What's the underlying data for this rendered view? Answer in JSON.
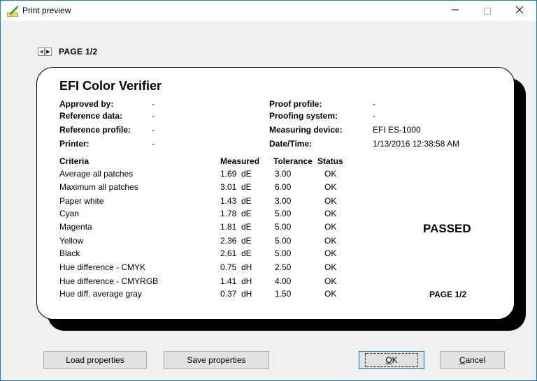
{
  "window": {
    "title": "Print preview"
  },
  "pager": {
    "label": "PAGE 1/2"
  },
  "report": {
    "title": "EFI Color Verifier",
    "left_fields": [
      {
        "label": "Approved by:",
        "value": "-"
      },
      {
        "label": "Reference data:",
        "value": "-"
      },
      {
        "label": "Reference profile:",
        "value": "-"
      },
      {
        "label": "Printer:",
        "value": "-"
      }
    ],
    "right_fields": [
      {
        "label": "Proof profile:",
        "value": "-"
      },
      {
        "label": "Proofing system:",
        "value": "-"
      },
      {
        "label": "Measuring device:",
        "value": "EFI ES-1000"
      },
      {
        "label": "Date/Time:",
        "value": "1/13/2016 12:38:58 AM"
      }
    ],
    "columns": {
      "criteria": "Criteria",
      "measured": "Measured",
      "tolerance": "Tolerance",
      "status": "Status"
    },
    "rows": [
      {
        "criteria": "Average all patches",
        "measured": "1.69",
        "unit": "dE",
        "tolerance": "3.00",
        "status": "OK"
      },
      {
        "criteria": "Maximum all patches",
        "measured": "3.01",
        "unit": "dE",
        "tolerance": "6.00",
        "status": "OK"
      },
      {
        "criteria": "Paper white",
        "measured": "1.43",
        "unit": "dE",
        "tolerance": "3.00",
        "status": "OK"
      },
      {
        "criteria": "Cyan",
        "measured": "1.78",
        "unit": "dE",
        "tolerance": "5.00",
        "status": "OK"
      },
      {
        "criteria": "Magenta",
        "measured": "1.81",
        "unit": "dE",
        "tolerance": "5.00",
        "status": "OK"
      },
      {
        "criteria": "Yellow",
        "measured": "2.36",
        "unit": "dE",
        "tolerance": "5.00",
        "status": "OK"
      },
      {
        "criteria": "Black",
        "measured": "2.61",
        "unit": "dE",
        "tolerance": "5.00",
        "status": "OK"
      },
      {
        "criteria": "Hue difference - CMYK",
        "measured": "0.75",
        "unit": "dH",
        "tolerance": "2.50",
        "status": "OK"
      },
      {
        "criteria": "Hue difference - CMYRGB",
        "measured": "1.41",
        "unit": "dH",
        "tolerance": "4.00",
        "status": "OK"
      },
      {
        "criteria": "Hue diff. average gray",
        "measured": "0.37",
        "unit": "dH",
        "tolerance": "1.50",
        "status": "OK"
      }
    ],
    "result": "PASSED",
    "page_footer": "PAGE 1/2"
  },
  "buttons": {
    "load": "Load properties",
    "save": "Save properties",
    "ok_prefix": "O",
    "ok_rest": "K",
    "cancel_prefix": "C",
    "cancel_rest": "ancel"
  },
  "icons": {
    "app": "pencil-ruler-icon",
    "minimize": "minimize-icon",
    "maximize": "maximize-icon",
    "close": "close-icon",
    "prev": "prev-page-icon",
    "next": "next-page-icon"
  },
  "colors": {
    "window_border": "#1883d7",
    "button_face": "#e1e1e1",
    "default_button_border": "#0078d7"
  }
}
